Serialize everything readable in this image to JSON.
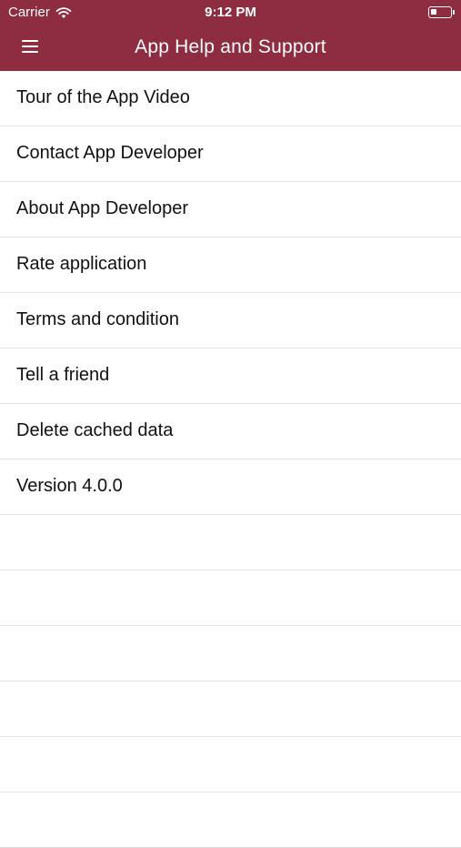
{
  "status_bar": {
    "carrier": "Carrier",
    "time": "9:12 PM",
    "wifi_icon": "wifi-icon",
    "battery_icon": "battery-icon"
  },
  "header": {
    "title": "App Help and Support",
    "menu_icon": "hamburger-menu-icon",
    "background_color": "#8e2c41"
  },
  "menu": {
    "items": [
      {
        "label": "Tour of the App Video"
      },
      {
        "label": "Contact App Developer"
      },
      {
        "label": "About App Developer"
      },
      {
        "label": "Rate application"
      },
      {
        "label": "Terms and condition"
      },
      {
        "label": "Tell a friend"
      },
      {
        "label": "Delete cached data"
      },
      {
        "label": "Version 4.0.0"
      },
      {
        "label": ""
      },
      {
        "label": ""
      },
      {
        "label": ""
      },
      {
        "label": ""
      },
      {
        "label": ""
      },
      {
        "label": ""
      }
    ]
  }
}
